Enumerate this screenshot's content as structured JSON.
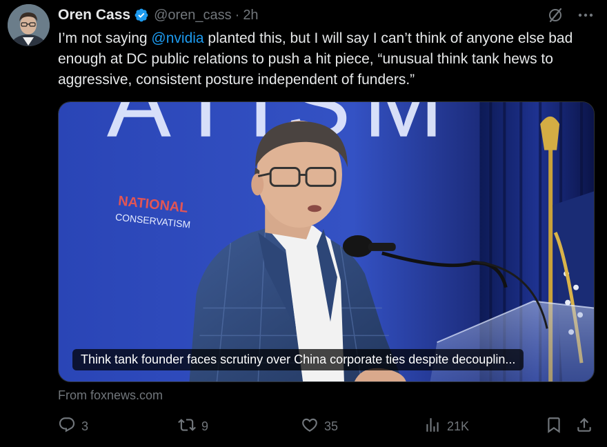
{
  "tweet": {
    "author_name": "Oren Cass",
    "handle": "@oren_cass",
    "separator": "·",
    "time": "2h",
    "text_before": "I’m not saying ",
    "mention": "@nvidia",
    "text_after": " planted this, but I will say I can’t think of anyone else bad enough at DC public relations to push a hit piece, “unusual think tank hews to aggressive, consistent posture independent of funders.”"
  },
  "card": {
    "caption": "Think tank founder faces scrutiny over China corporate ties despite decouplin...",
    "source": "From foxnews.com",
    "photo_signage": {
      "big_letters": "ATISM",
      "sign_line1": "NATIONAL",
      "sign_line2": "CONSERVATISM"
    }
  },
  "actions": {
    "replies": "3",
    "reposts": "9",
    "likes": "35",
    "views": "21K"
  },
  "icons": [
    "verified-badge-icon",
    "grok-slash-icon",
    "more-icon",
    "reply-icon",
    "repost-icon",
    "like-icon",
    "views-icon",
    "bookmark-icon",
    "share-icon"
  ],
  "colors": {
    "background": "#000000",
    "text": "#e7e9ea",
    "muted": "#71767b",
    "accent": "#1d9bf0"
  }
}
